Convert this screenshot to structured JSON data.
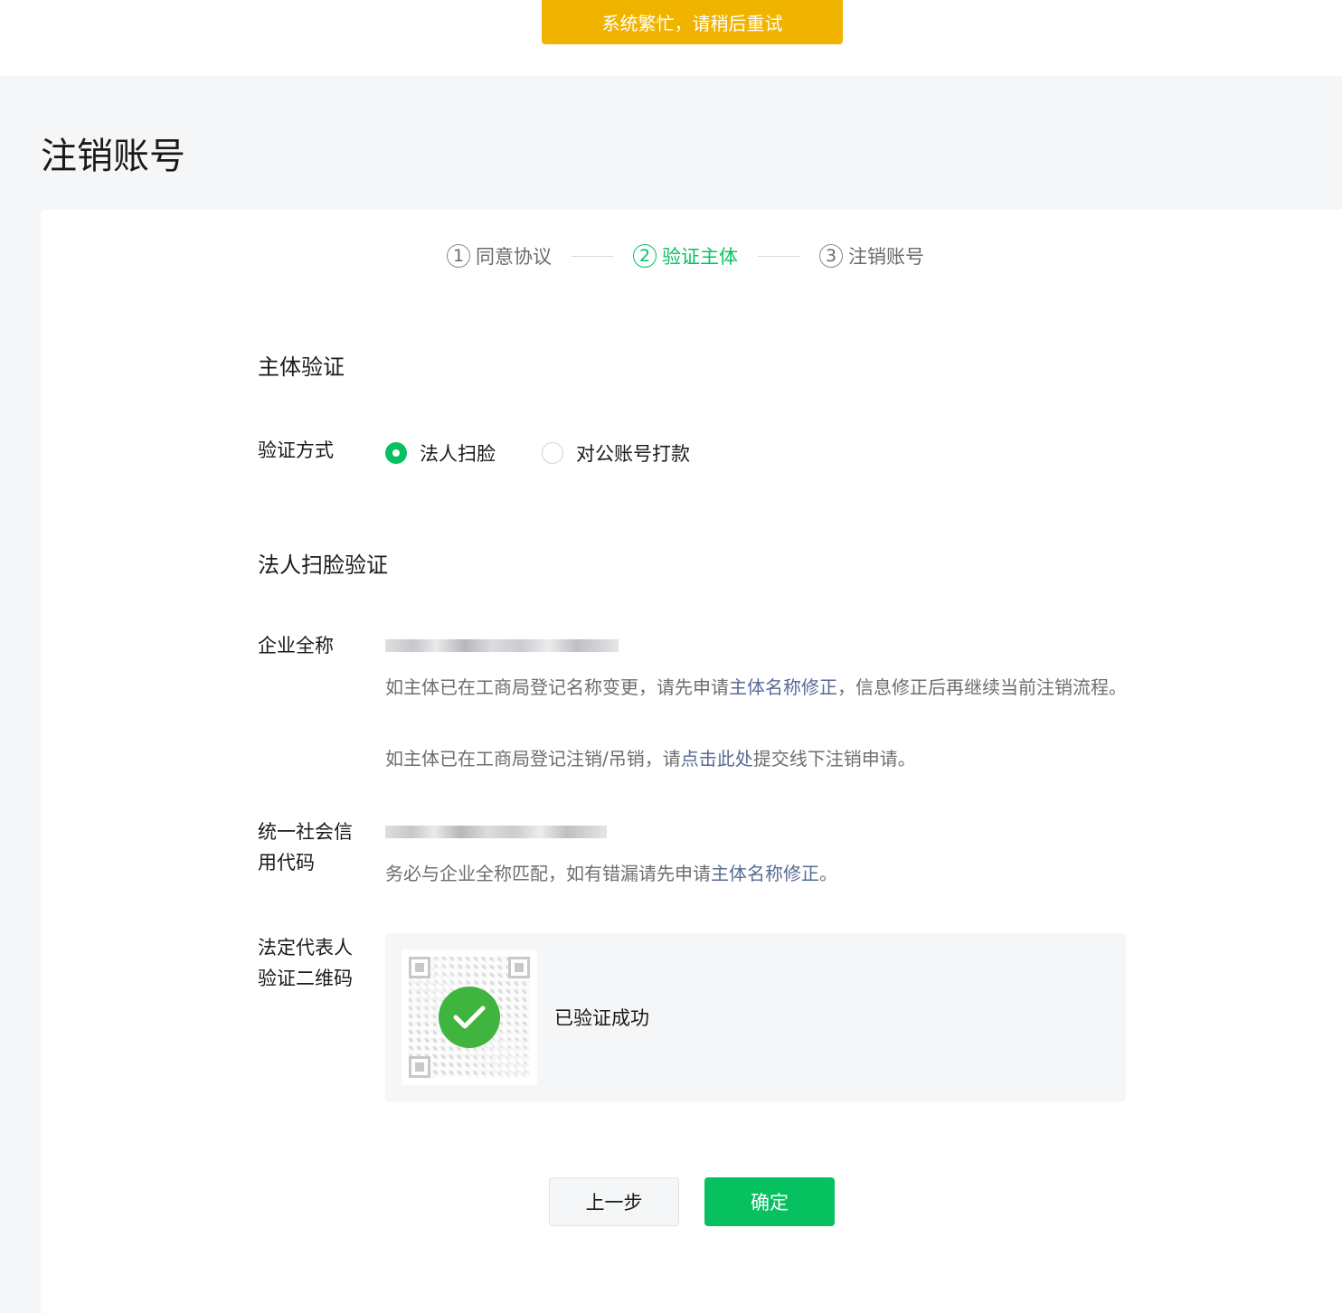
{
  "toast": {
    "text": "系统繁忙，请稍后重试"
  },
  "page": {
    "title": "注销账号"
  },
  "steps": [
    {
      "num": "1",
      "label": "同意协议"
    },
    {
      "num": "2",
      "label": "验证主体"
    },
    {
      "num": "3",
      "label": "注销账号"
    }
  ],
  "section": {
    "subject_verify_title": "主体验证",
    "method_label": "验证方式",
    "options": [
      {
        "label": "法人扫脸",
        "selected": true
      },
      {
        "label": "对公账号打款",
        "selected": false
      }
    ],
    "face_verify_title": "法人扫脸验证"
  },
  "company": {
    "label": "企业全称",
    "hint1_pre": "如主体已在工商局登记名称变更，请先申请",
    "hint1_link": "主体名称修正",
    "hint1_post": "，信息修正后再继续当前注销流程。",
    "hint2_pre": "如主体已在工商局登记注销/吊销，请",
    "hint2_link": "点击此处",
    "hint2_post": "提交线下注销申请。"
  },
  "credit_code": {
    "label_line1": "统一社会信",
    "label_line2": "用代码",
    "hint_pre": "务必与企业全称匹配，如有错漏请先申请",
    "hint_link": "主体名称修正",
    "hint_post": "。"
  },
  "qrcode": {
    "label_line1": "法定代表人",
    "label_line2": "验证二维码",
    "status": "已验证成功"
  },
  "buttons": {
    "prev": "上一步",
    "confirm": "确定"
  },
  "colors": {
    "accent": "#07c160",
    "toast": "#f0b400",
    "link": "#576b95"
  }
}
